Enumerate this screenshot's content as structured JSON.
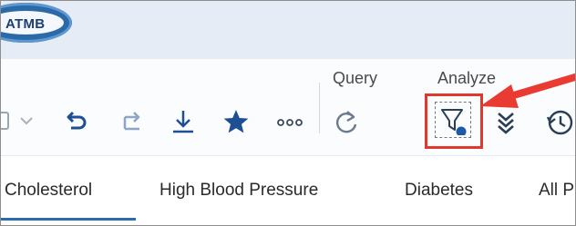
{
  "app": {
    "logo_text": "ATMB"
  },
  "toolbar": {
    "groups": {
      "query": "Query",
      "analyze": "Analyze"
    },
    "icons": {
      "dropdown": "chevron-down-icon",
      "undo": "undo-icon",
      "redo": "redo-icon",
      "download": "download-icon",
      "favorite": "star-icon",
      "more": "more-icon",
      "refresh": "refresh-icon",
      "filter": "filter-icon",
      "collapse": "double-chevron-down-icon",
      "history": "history-icon"
    },
    "filter_highlighted": true
  },
  "tabs": [
    {
      "label": "Cholesterol",
      "selected": true
    },
    {
      "label": "High Blood Pressure",
      "selected": false
    },
    {
      "label": "Diabetes",
      "selected": false
    },
    {
      "label": "All P",
      "selected": false
    }
  ],
  "colors": {
    "accent": "#2b6cb0",
    "highlight": "#e0382d",
    "arrow": "#ea3b33",
    "icon": "#1f4f93"
  }
}
